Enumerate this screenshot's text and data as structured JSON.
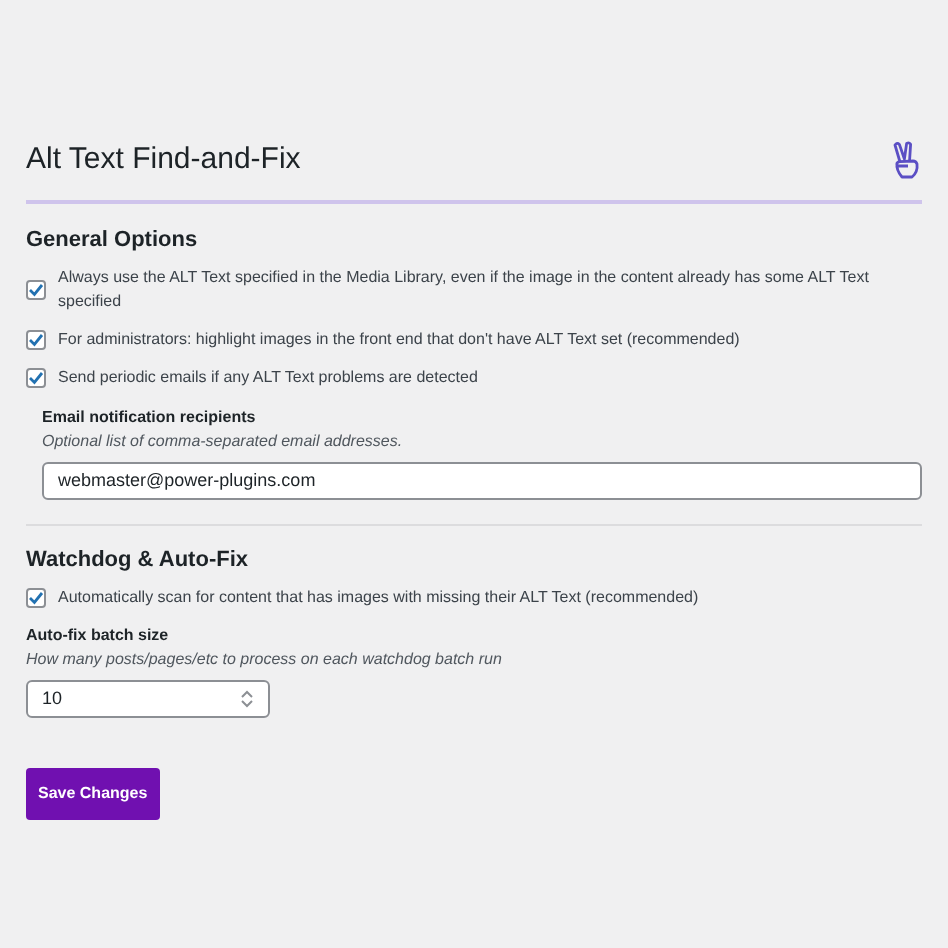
{
  "title": "Alt Text Find-and-Fix",
  "general": {
    "heading": "General Options",
    "options": [
      {
        "label": "Always use the ALT Text specified in the Media Library, even if the image in the content already has some ALT Text specified",
        "checked": true
      },
      {
        "label": "For administrators: highlight images in the front end that don't have ALT Text set (recommended)",
        "checked": true
      },
      {
        "label": "Send periodic emails if any ALT Text problems are detected",
        "checked": true
      }
    ],
    "email": {
      "label": "Email notification recipients",
      "hint": "Optional list of comma-separated email addresses.",
      "value": "webmaster@power-plugins.com"
    }
  },
  "watchdog": {
    "heading": "Watchdog & Auto-Fix",
    "options": [
      {
        "label": "Automatically scan for content that has images with missing their ALT Text (recommended)",
        "checked": true
      }
    ],
    "batch": {
      "label": "Auto-fix batch size",
      "hint": "How many posts/pages/etc to process on each watchdog batch run",
      "value": "10"
    }
  },
  "save_button": "Save Changes"
}
